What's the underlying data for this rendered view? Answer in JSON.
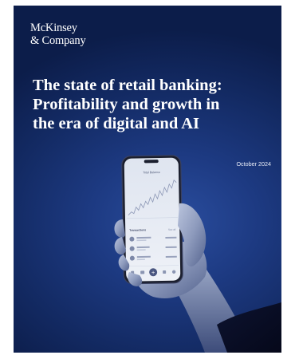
{
  "brand": {
    "logo_line1": "McKinsey",
    "logo_line2": "& Company"
  },
  "cover": {
    "title_line1": "The state of retail banking:",
    "title_line2": "Profitability and growth in",
    "title_line3": "the era of digital and AI",
    "date": "October 2024"
  },
  "phone_app": {
    "chart_title": "Total Balance",
    "section_title": "Transactions",
    "section_action": "See all"
  },
  "colors": {
    "background_dark": "#0c1d4a",
    "background_mid": "#1d3a82",
    "text": "#ffffff"
  },
  "icons": [
    "hand-holding-phone",
    "line-chart",
    "add-icon",
    "home-icon",
    "card-icon",
    "user-icon"
  ]
}
